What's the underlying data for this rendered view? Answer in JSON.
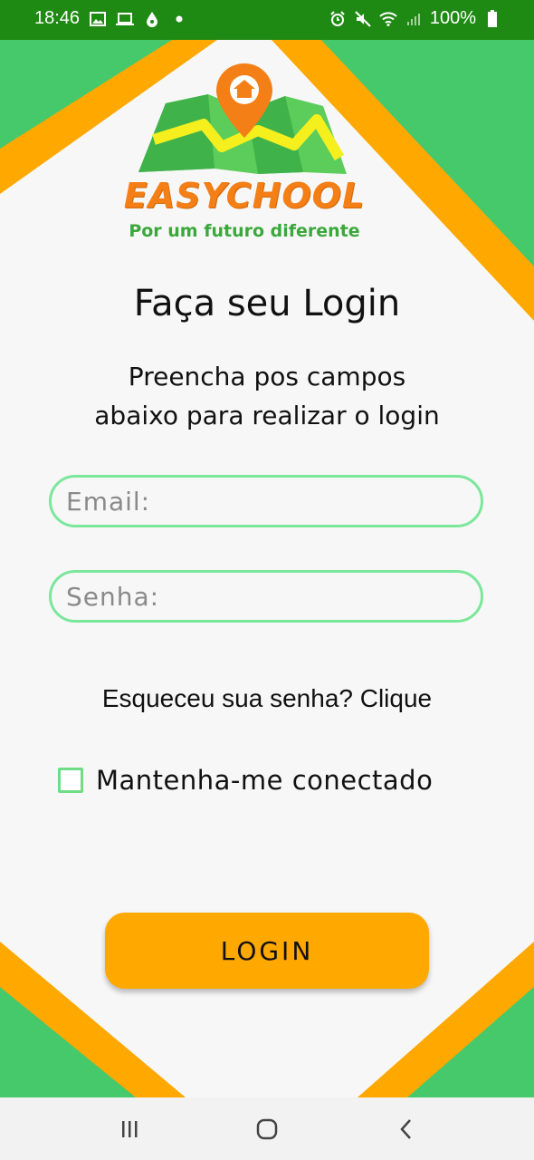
{
  "status_bar": {
    "time": "18:46",
    "battery": "100%",
    "left_icons": [
      "image-icon",
      "laptop-icon",
      "drop-icon",
      "dot-icon"
    ],
    "right_icons": [
      "alarm-icon",
      "mute-icon",
      "wifi-icon",
      "signal-icon",
      "battery-icon"
    ]
  },
  "logo": {
    "name": "EASYCHOOL",
    "tagline": "Por um futuro diferente"
  },
  "colors": {
    "status_bar": "#1f8a13",
    "green_accent": "#45c96b",
    "orange_accent": "#ffa800",
    "field_border": "#7be79b"
  },
  "login": {
    "title": "Faça seu Login",
    "subtitle_line1": "Preencha pos campos",
    "subtitle_line2": "abaixo para realizar o login",
    "email_placeholder": "Email:",
    "password_placeholder": "Senha:",
    "forgot_text": "Esqueceu sua senha? Clique",
    "remember_label": "Mantenha-me conectado",
    "remember_checked": false,
    "button_label": "LOGIN"
  },
  "nav_bar": {
    "buttons": [
      "recent-apps-icon",
      "home-icon",
      "back-icon"
    ]
  }
}
